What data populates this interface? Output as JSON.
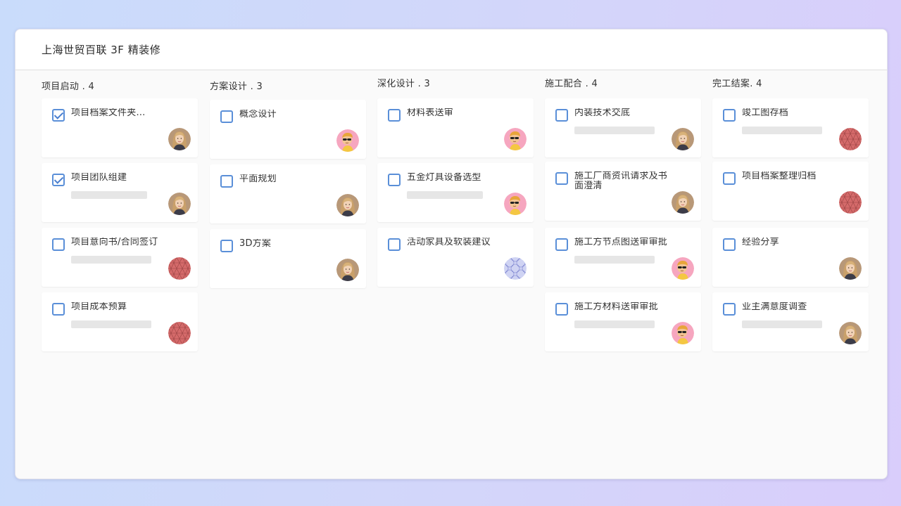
{
  "header": {
    "title": "上海世贸百联 3F 精装修"
  },
  "columns": [
    {
      "title": "项目启动 . 4",
      "cards": [
        {
          "title": "项目档案文件夹…",
          "checked": true,
          "bar": false,
          "avatar": "woman"
        },
        {
          "title": "项目团队组建",
          "checked": true,
          "bar": true,
          "avatar": "woman"
        },
        {
          "title": "项目意向书/合同签订",
          "checked": false,
          "bar": true,
          "avatar": "pattern-red"
        },
        {
          "title": "项目成本预算",
          "checked": false,
          "bar": true,
          "avatar": "pattern-red"
        }
      ]
    },
    {
      "title": "方案设计 . 3",
      "cards": [
        {
          "title": "概念设计",
          "checked": false,
          "bar": false,
          "avatar": "sunglasses"
        },
        {
          "title": "平面规划",
          "checked": false,
          "bar": false,
          "avatar": "woman"
        },
        {
          "title": "3D方案",
          "checked": false,
          "bar": false,
          "avatar": "woman"
        }
      ]
    },
    {
      "title": "深化设计 . 3",
      "cards": [
        {
          "title": "材料表送审",
          "checked": false,
          "bar": false,
          "avatar": "sunglasses"
        },
        {
          "title": "五金灯具设备选型",
          "checked": false,
          "bar": true,
          "avatar": "sunglasses"
        },
        {
          "title": "活动家具及软装建议",
          "checked": false,
          "bar": false,
          "avatar": "pattern-blue"
        }
      ]
    },
    {
      "title": "施工配合 . 4",
      "cards": [
        {
          "title": "内装技术交底",
          "checked": false,
          "bar": true,
          "avatar": "woman"
        },
        {
          "title": "施工厂商资讯请求及书面澄清",
          "checked": false,
          "bar": false,
          "avatar": "woman"
        },
        {
          "title": "施工方节点图送审审批",
          "checked": false,
          "bar": true,
          "avatar": "sunglasses"
        },
        {
          "title": "施工方材料送审审批",
          "checked": false,
          "bar": true,
          "avatar": "sunglasses"
        }
      ]
    },
    {
      "title": "完工结案. 4",
      "cards": [
        {
          "title": "竣工图存档",
          "checked": false,
          "bar": true,
          "avatar": "pattern-red"
        },
        {
          "title": "项目档案整理归档",
          "checked": false,
          "bar": false,
          "avatar": "pattern-red"
        },
        {
          "title": "经验分享",
          "checked": false,
          "bar": false,
          "avatar": "woman"
        },
        {
          "title": "业主满意度调查",
          "checked": false,
          "bar": true,
          "avatar": "woman"
        }
      ]
    }
  ],
  "colors": {
    "accent": "#5a8fd8",
    "placeholder_bar": "#e6e6e6",
    "avatar_red": "#d46a6a",
    "avatar_blue": "#c8cdf0"
  }
}
